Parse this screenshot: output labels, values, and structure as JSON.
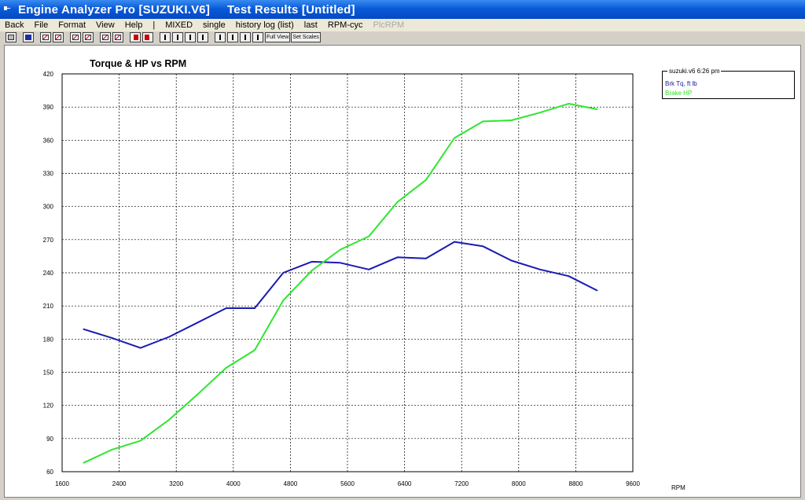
{
  "window": {
    "title": "Engine Analyzer Pro [SUZUKI.V6]",
    "subtitle": "Test Results [Untitled]"
  },
  "menu": {
    "items": [
      {
        "label": "Back",
        "enabled": true
      },
      {
        "label": "File",
        "enabled": true
      },
      {
        "label": "Format",
        "enabled": true
      },
      {
        "label": "View",
        "enabled": true
      },
      {
        "label": "Help",
        "enabled": true
      },
      {
        "label": "|",
        "enabled": true
      },
      {
        "label": "MIXED",
        "enabled": true
      },
      {
        "label": "single",
        "enabled": true
      },
      {
        "label": "history log (list)",
        "enabled": true
      },
      {
        "label": "last",
        "enabled": true
      },
      {
        "label": "RPM-cyc",
        "enabled": true
      },
      {
        "label": "PlcRPM",
        "enabled": false
      }
    ]
  },
  "toolbar": {
    "buttons": [
      {
        "name": "print-icon"
      },
      {
        "name": "save-icon"
      },
      {
        "name": "graph-icon"
      },
      {
        "name": "graph-overlay-icon"
      },
      {
        "name": "graph-stack-icon"
      },
      {
        "name": "graph-edit-icon"
      },
      {
        "name": "graph-color-icon"
      },
      {
        "name": "graph-grid-icon"
      },
      {
        "name": "arrow-left-icon"
      },
      {
        "name": "arrow-right-icon"
      },
      {
        "name": "scroll-left-icon"
      },
      {
        "name": "scroll-right-icon"
      },
      {
        "name": "scroll-up-icon"
      },
      {
        "name": "scroll-down-icon"
      },
      {
        "name": "shrink-horizontal-icon"
      },
      {
        "name": "expand-horizontal-icon"
      },
      {
        "name": "shrink-vertical-icon"
      },
      {
        "name": "expand-vertical-icon"
      }
    ],
    "full_view_label": "Full View",
    "set_scales_label": "Set Scales"
  },
  "legend": {
    "title": "suzuki.v6 6:26 pm",
    "entries": [
      "Brk Tq, ft lb",
      "Brake HP"
    ]
  },
  "colors": {
    "torque": "#1a1ab4",
    "hp": "#2ee62e",
    "grid": "#000000",
    "titlebar": "#0a5bd8"
  },
  "chart_data": {
    "type": "line",
    "title": "Torque & HP vs RPM",
    "xlabel": "RPM",
    "ylabel": "",
    "xlim": [
      1600,
      9600
    ],
    "ylim": [
      60,
      420
    ],
    "xticks": [
      1600,
      2400,
      3200,
      4000,
      4800,
      5600,
      6400,
      7200,
      8000,
      8800,
      9600
    ],
    "yticks": [
      60,
      90,
      120,
      150,
      180,
      210,
      240,
      270,
      300,
      330,
      360,
      390,
      420
    ],
    "grid": true,
    "legend_position": "top-right",
    "series": [
      {
        "name": "Brk Tq, ft lb",
        "color": "#1a1ab4",
        "x": [
          1900,
          2300,
          2700,
          3100,
          3500,
          3900,
          4300,
          4700,
          5100,
          5500,
          5900,
          6300,
          6700,
          7100,
          7500,
          7900,
          8300,
          8700,
          9100
        ],
        "y": [
          189,
          181,
          172,
          182,
          195,
          208,
          208,
          240,
          250,
          249,
          243,
          254,
          253,
          268,
          264,
          251,
          243,
          237,
          224
        ]
      },
      {
        "name": "Brake HP",
        "color": "#2ee62e",
        "x": [
          1900,
          2300,
          2700,
          3100,
          3500,
          3900,
          4300,
          4700,
          5100,
          5500,
          5900,
          6300,
          6700,
          7100,
          7500,
          7900,
          8300,
          8700,
          9100
        ],
        "y": [
          68,
          80,
          88,
          107,
          130,
          154,
          170,
          215,
          242,
          261,
          273,
          304,
          324,
          362,
          377,
          378,
          385,
          393,
          388
        ]
      }
    ]
  }
}
